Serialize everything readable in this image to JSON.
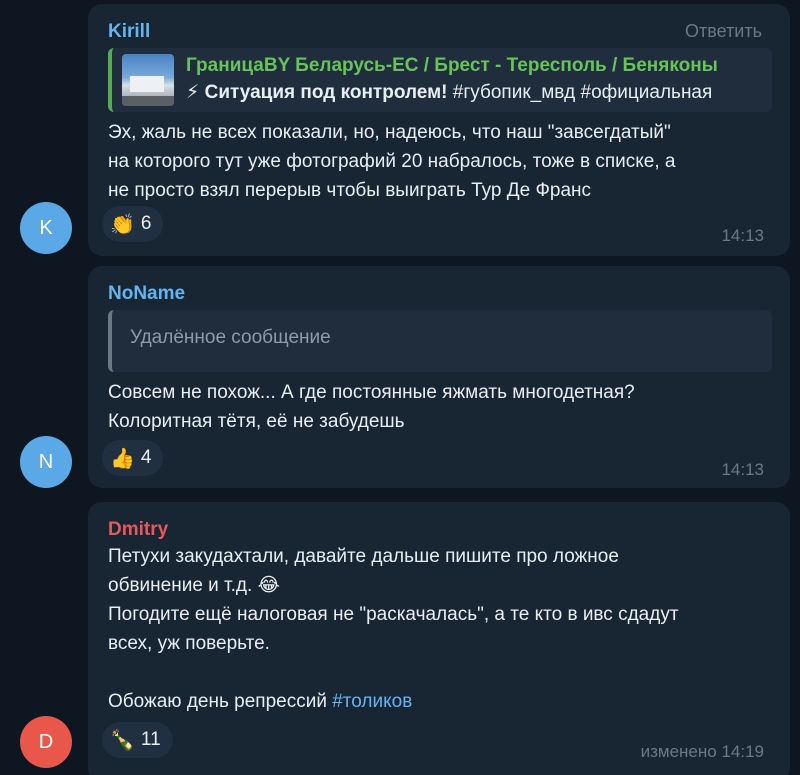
{
  "reply_label": "Ответить",
  "messages": [
    {
      "author": "Kirill",
      "author_color": "#64b5ef",
      "avatar_letter": "K",
      "avatar_color": "#5ba8e6",
      "quote": {
        "title": "ГраницаBY Беларусь-ЕС / Брест - Тересполь / Беняконы",
        "sub_bold": "⚡ Ситуация под контролем!",
        "sub_rest": " #губопик_мвд #официальная"
      },
      "lines": [
        "Эх, жаль не всех показали, но, надеюсь, что наш \"завсегдатый\"",
        "на которого тут уже фотографий 20 набралось, тоже в списке, а",
        "не просто взял перерыв чтобы выиграть Тур Де Франс"
      ],
      "reaction": {
        "emoji": "👏",
        "icon": "clapping-hands-icon",
        "count": "6"
      },
      "time": "14:13"
    },
    {
      "author": "NoName",
      "author_color": "#64b5ef",
      "avatar_letter": "N",
      "avatar_color": "#5ba8e6",
      "quote": {
        "deleted": "Удалённое сообщение"
      },
      "lines": [
        "Совсем не похож... А где постоянные яжмать многодетная?",
        "Колоритная тётя, её не забудешь"
      ],
      "reaction": {
        "emoji": "👍",
        "icon": "thumbs-up-icon",
        "count": "4"
      },
      "time": "14:13"
    },
    {
      "author": "Dmitry",
      "author_color": "#e8575d",
      "avatar_letter": "D",
      "avatar_color": "#e8574a",
      "lines": [
        "Петухи закудахтали, давайте дальше пишите про ложное",
        "обвинение и т.д.  😂",
        "Погодите ещё налоговая не \"раскачалась\", а те кто в ивс сдадут",
        "всех, уж поверьте.",
        "",
        "Обожаю день репрессий "
      ],
      "hashtag": "#толиков",
      "reaction": {
        "emoji": "🍾",
        "icon": "champagne-icon",
        "count": "11"
      },
      "edited": "изменено",
      "time": "14:19"
    }
  ]
}
